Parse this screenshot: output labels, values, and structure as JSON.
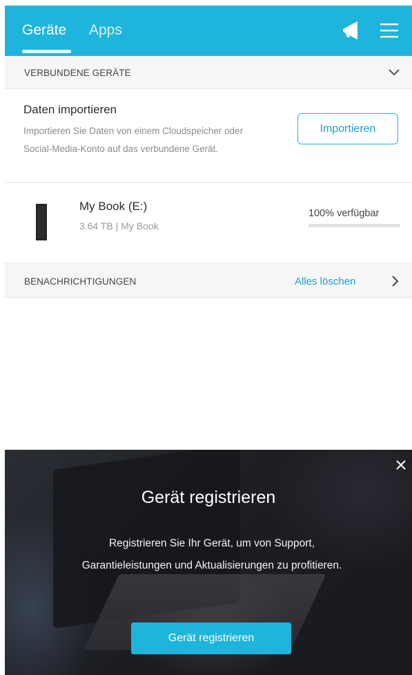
{
  "header": {
    "tab_devices": "Geräte",
    "tab_apps": "Apps",
    "accent_color": "#1fb4dc",
    "icons": [
      "megaphone-icon",
      "hamburger-menu-icon"
    ]
  },
  "connected_section": {
    "title": "VERBUNDENE GERÄTE"
  },
  "import": {
    "title": "Daten importieren",
    "description": "Importieren Sie Daten von einem Cloudspeicher oder Social-Media-Konto auf das verbundene Gerät.",
    "button_label": "Importieren"
  },
  "device": {
    "name": "My Book (E:)",
    "meta": "3.64 TB | My Book",
    "availability": "100% verfügbar",
    "available_fraction": 1.0
  },
  "notifications": {
    "title": "BENACHRICHTIGUNGEN",
    "clear_label": "Alles löschen"
  },
  "register_banner": {
    "title": "Gerät registrieren",
    "text": "Registrieren Sie Ihr Gerät, um von Support, Garantieleistungen und Aktualisierungen zu profitieren.",
    "button_label": "Gerät registrieren"
  }
}
